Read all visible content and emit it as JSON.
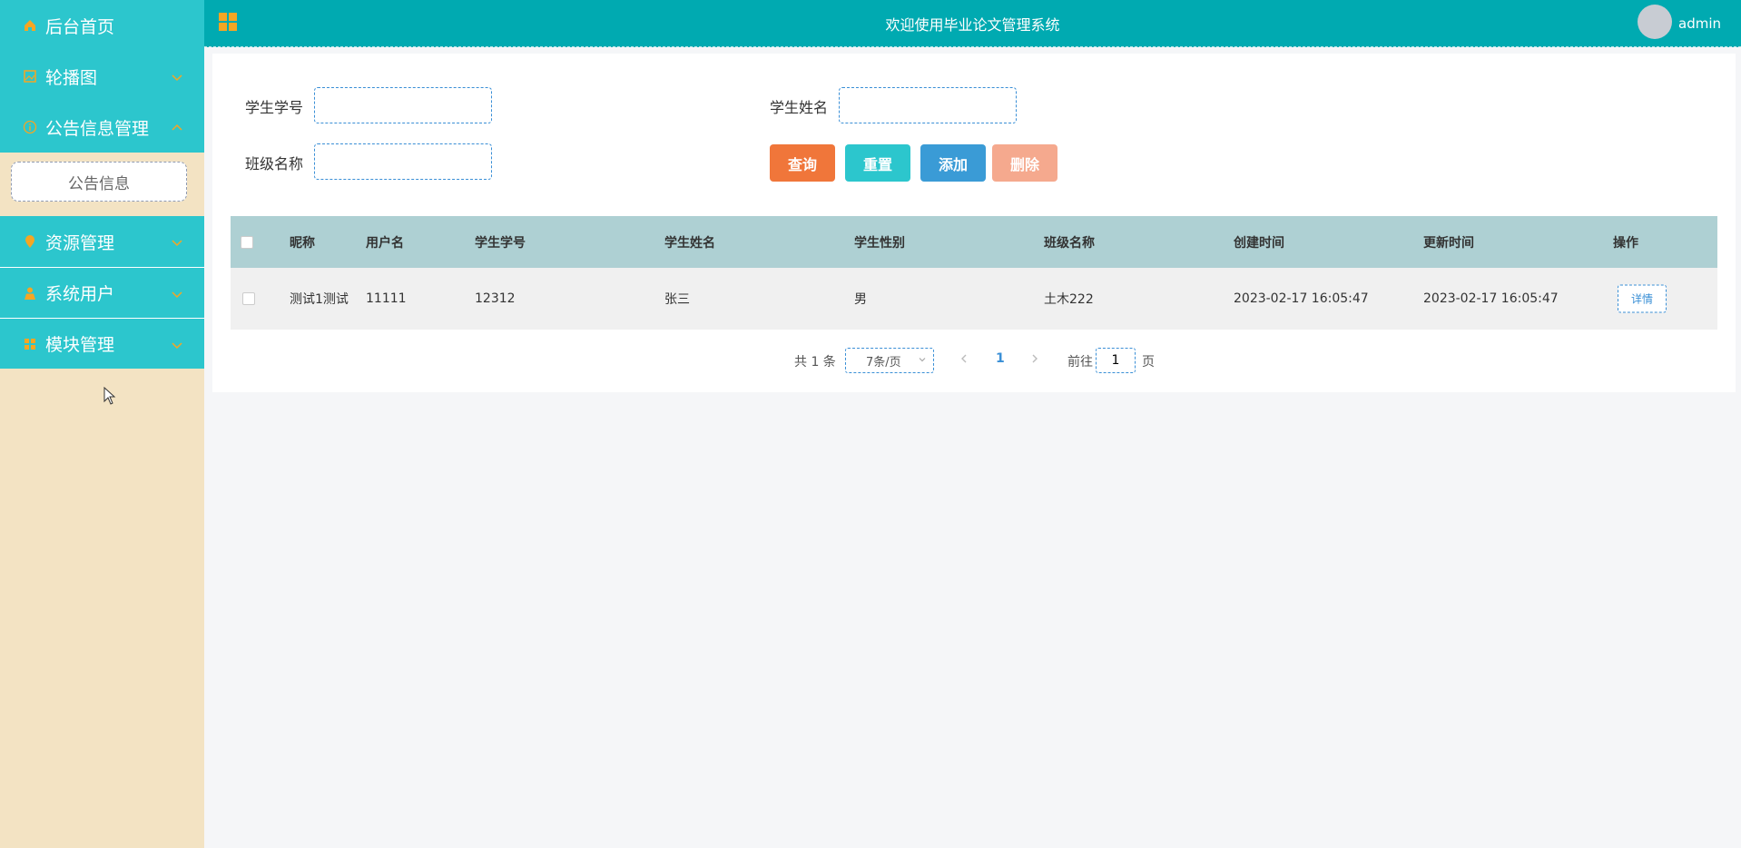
{
  "sidebar": {
    "items": [
      {
        "label": "后台首页",
        "icon": "home-icon"
      },
      {
        "label": "轮播图",
        "icon": "image-icon"
      },
      {
        "label": "公告信息管理",
        "icon": "info-icon",
        "expanded": true
      },
      {
        "label": "资源管理",
        "icon": "location-icon"
      },
      {
        "label": "系统用户",
        "icon": "user-icon"
      },
      {
        "label": "模块管理",
        "icon": "grid-icon"
      }
    ],
    "submenu": {
      "label": "公告信息"
    }
  },
  "header": {
    "title": "欢迎使用毕业论文管理系统",
    "username": "admin"
  },
  "search": {
    "student_no_label": "学生学号",
    "student_name_label": "学生姓名",
    "class_name_label": "班级名称",
    "student_no_value": "",
    "student_name_value": "",
    "class_name_value": ""
  },
  "buttons": {
    "query": "查询",
    "reset": "重置",
    "add": "添加",
    "delete": "删除"
  },
  "table": {
    "columns": [
      "昵称",
      "用户名",
      "学生学号",
      "学生姓名",
      "学生性别",
      "班级名称",
      "创建时间",
      "更新时间",
      "操作"
    ],
    "rows": [
      {
        "nickname": "测试1测试",
        "username": "11111",
        "student_no": "12312",
        "student_name": "张三",
        "gender": "男",
        "class_name": "土木222",
        "created": "2023-02-17 16:05:47",
        "updated": "2023-02-17 16:05:47",
        "action": "详情"
      }
    ]
  },
  "pagination": {
    "total": "共 1 条",
    "page_size": "7条/页",
    "current": "1",
    "goto_prefix": "前往",
    "goto_value": "1",
    "goto_suffix": "页"
  },
  "colors": {
    "sidebar_item": "#2cc6cd",
    "sidebar_bg": "#f3e3c3",
    "header": "#00aab1",
    "table_head": "#aed0d3",
    "query_btn": "#f0763a",
    "reset_btn": "#2cc6cd",
    "add_btn": "#3a9bd6",
    "delete_btn": "#f5a98e",
    "icon_accent": "#f5a623"
  }
}
